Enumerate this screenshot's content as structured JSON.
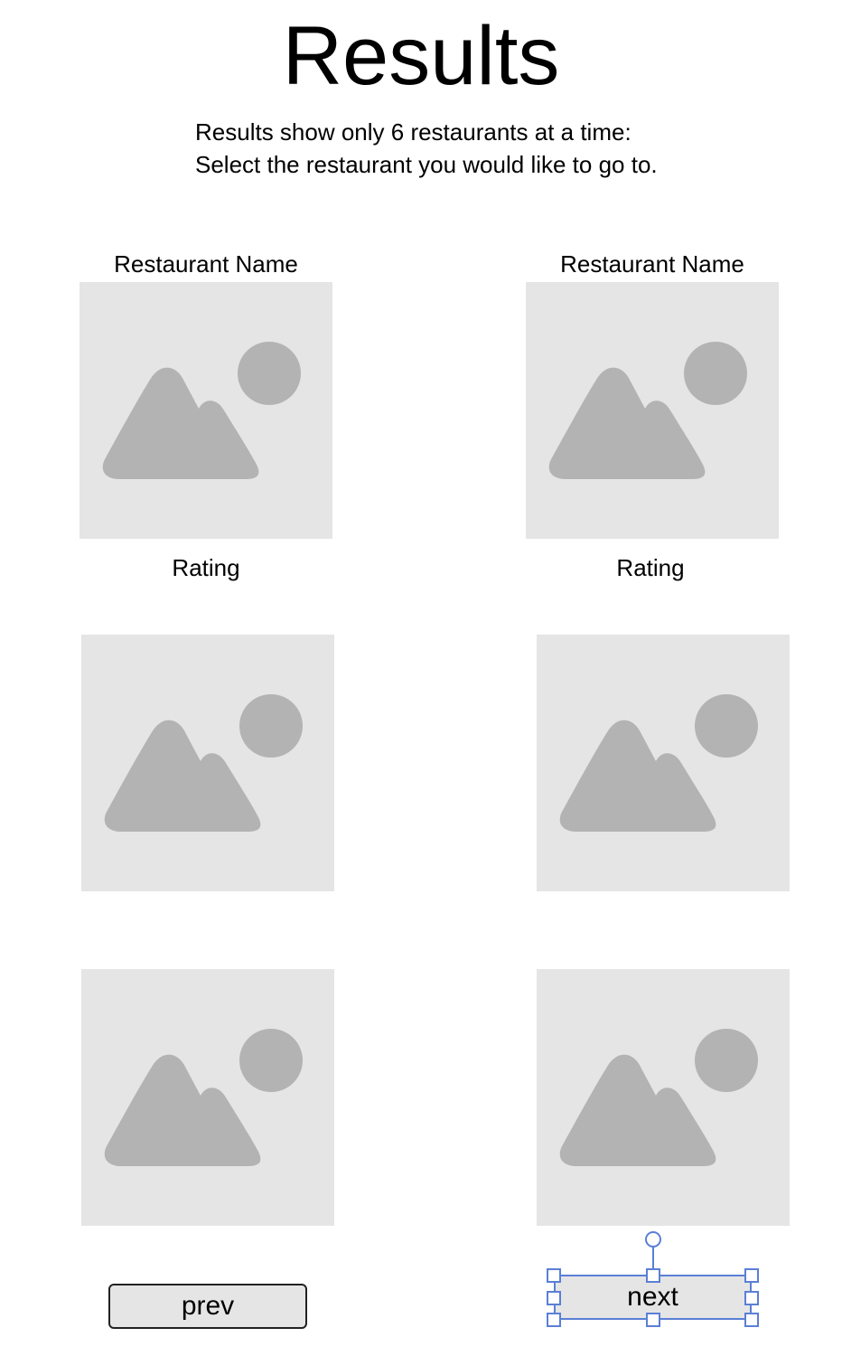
{
  "page": {
    "title": "Results",
    "instructions": "Results show only 6 restaurants at a time: Select the restaurant you would like to go to."
  },
  "cards": [
    {
      "name_label": "Restaurant Name",
      "rating_label": "Rating",
      "image_icon": "image-placeholder-icon"
    },
    {
      "name_label": "Restaurant Name",
      "rating_label": "Rating",
      "image_icon": "image-placeholder-icon"
    },
    {
      "image_icon": "image-placeholder-icon"
    },
    {
      "image_icon": "image-placeholder-icon"
    },
    {
      "image_icon": "image-placeholder-icon"
    },
    {
      "image_icon": "image-placeholder-icon"
    }
  ],
  "pagination": {
    "prev_label": "prev",
    "next_label": "next"
  },
  "colors": {
    "placeholder_background": "#e5e5e5",
    "placeholder_icon": "#b3b3b3",
    "selection_handles": "#5b7fd6"
  }
}
